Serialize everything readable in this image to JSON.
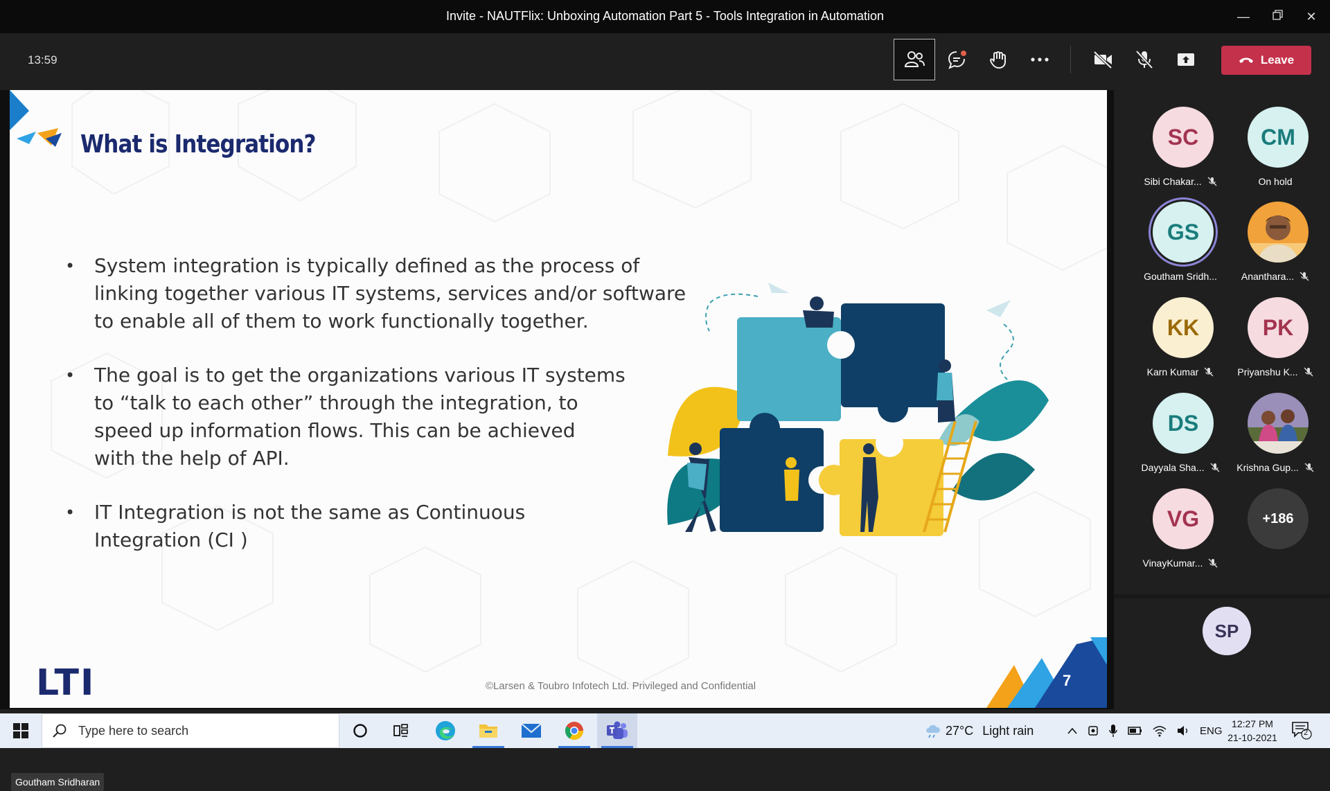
{
  "window": {
    "title": "Invite - NAUTFlix: Unboxing Automation Part 5 - Tools Integration in Automation",
    "controls": [
      "minimize",
      "restore",
      "close"
    ]
  },
  "meeting": {
    "timer": "13:59",
    "leave_label": "Leave",
    "toolbar_icons": [
      "people-icon",
      "chat-icon",
      "raise-hand-icon",
      "more-icon",
      "camera-off-icon",
      "mic-off-icon",
      "share-icon",
      "phone-icon"
    ]
  },
  "slide": {
    "title": "What is Integration?",
    "bullets": [
      [
        "System integration is typically defined as the process of",
        "linking together various IT systems, services and/or software",
        "to enable all of them to work functionally together."
      ],
      [
        "The goal is to get the organizations various IT systems",
        "to “talk to each other” through the integration, to",
        "speed up information flows. This can be achieved",
        "with the help of API."
      ],
      [
        "IT Integration is not  the same as Continuous",
        "Integration (CI )"
      ]
    ],
    "bullet_char": "•",
    "logo_text": "LTI",
    "copyright": "©Larsen & Toubro Infotech Ltd. Privileged and Confidential",
    "page_number": "7",
    "presenter_name": "Goutham Sridharan"
  },
  "participants": [
    {
      "initials": "SC",
      "name": "Sibi Chakar...",
      "muted": true,
      "color": "#f6dbe0",
      "text_color": "#a33450"
    },
    {
      "initials": "CM",
      "name": "On hold",
      "muted": false,
      "color": "#d6f1f0",
      "text_color": "#1a7c7c"
    },
    {
      "initials": "GS",
      "name": "Goutham Sridh...",
      "muted": false,
      "color": "#d6f1f0",
      "text_color": "#1a7c7c",
      "speaking": true
    },
    {
      "initials": "",
      "name": "Ananthara...",
      "muted": true,
      "photo": true
    },
    {
      "initials": "KK",
      "name": "Karn Kumar",
      "muted": true,
      "color": "#fbefd2",
      "text_color": "#9a6a07"
    },
    {
      "initials": "PK",
      "name": "Priyanshu K...",
      "muted": true,
      "color": "#f6dbe0",
      "text_color": "#a33450"
    },
    {
      "initials": "DS",
      "name": "Dayyala Sha...",
      "muted": true,
      "color": "#d6f1f0",
      "text_color": "#1a7c7c"
    },
    {
      "initials": "",
      "name": "Krishna Gup...",
      "muted": true,
      "photo": true
    },
    {
      "initials": "VG",
      "name": "VinayKumar...",
      "muted": true,
      "color": "#f6dbe0",
      "text_color": "#a33450"
    },
    {
      "initials": "+186",
      "name": "",
      "muted": false,
      "color": "#3b3b3b",
      "text_color": "#ffffff"
    }
  ],
  "self_view": {
    "initials": "SP",
    "color": "#e3dff3",
    "text_color": "#3a3458"
  },
  "taskbar": {
    "search_placeholder": "Type here to search",
    "weather_temp": "27°C",
    "weather_desc": "Light rain",
    "language": "ENG",
    "time": "12:27 PM",
    "date": "21-10-2021",
    "notification_count": "2",
    "apps": [
      "cortana-icon",
      "task-view-icon",
      "edge-icon",
      "file-explorer-icon",
      "mail-icon",
      "chrome-icon",
      "teams-icon"
    ]
  }
}
